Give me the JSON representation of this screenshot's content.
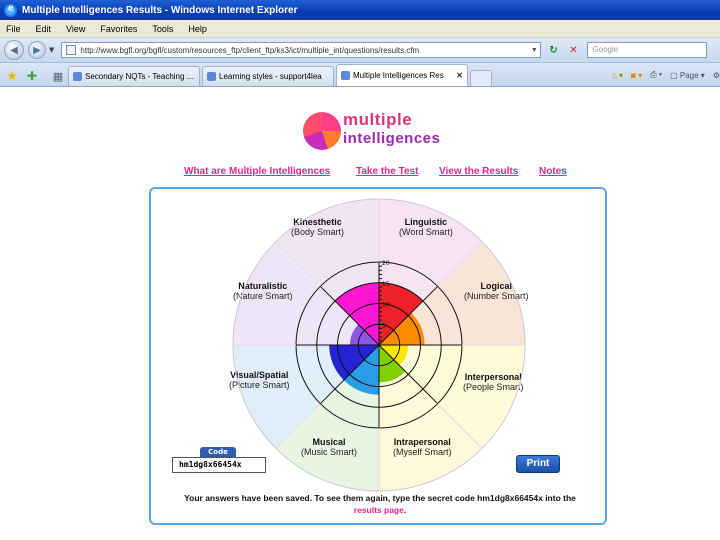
{
  "window": {
    "title": "Multiple Intelligences Results - Windows Internet Explorer"
  },
  "menu": [
    "File",
    "Edit",
    "View",
    "Favorites",
    "Tools",
    "Help"
  ],
  "address": {
    "url": "http://www.bgfl.org/bgfl/custom/resources_ftp/client_ftp/ks3/ict/multiple_int/questions/results.cfm"
  },
  "search": {
    "placeholder": "Google"
  },
  "tabs": [
    {
      "label": "Secondary NQTs - Teaching ..."
    },
    {
      "label": "Learning styles - support4lea"
    },
    {
      "label": "Multiple Intelligences Res"
    }
  ],
  "toolbar": {
    "page_label": "Page"
  },
  "logo": {
    "line1": "multiple",
    "line2": "intelligences"
  },
  "nav": [
    "What are Multiple Intelligences",
    "Take the Test",
    "View the Results",
    "Notes"
  ],
  "segments": [
    {
      "name": "Kinesthetic",
      "sub": "(Body Smart)"
    },
    {
      "name": "Linguistic",
      "sub": "(Word Smart)"
    },
    {
      "name": "Logical",
      "sub": "(Number Smart)"
    },
    {
      "name": "Interpersonal",
      "sub": "(People Smart)"
    },
    {
      "name": "Intrapersonal",
      "sub": "(Myself Smart)"
    },
    {
      "name": "Musical",
      "sub": "(Music Smart)"
    },
    {
      "name": "Visual/Spatial",
      "sub": "(Picture Smart)"
    },
    {
      "name": "Naturalistic",
      "sub": "(Nature Smart)"
    }
  ],
  "scale": [
    "20",
    "15",
    "10",
    "5"
  ],
  "scores": {
    "Linguistic": 15,
    "Logical": 11,
    "Interpersonal": 7,
    "Intrapersonal": 9,
    "Musical": 12,
    "Visual/Spatial": 12,
    "Naturalistic": 7,
    "Kinesthetic": 15
  },
  "colors": {
    "Kinesthetic": "#ff16d3",
    "Linguistic": "#f0202a",
    "Logical": "#ff8c00",
    "Interpersonal": "#ffe600",
    "Intrapersonal": "#7fd000",
    "Musical": "#2a9de8",
    "Visual/Spatial": "#2424d6",
    "Naturalistic": "#8b55e6"
  },
  "code": {
    "label": "Code",
    "value": "hm1dg8x66454x"
  },
  "print_label": "Print",
  "saved": {
    "line1": "Your answers have been saved. To see them again, type the secret code hm1dg8x66454x into the",
    "link": "results page",
    "end": "."
  }
}
